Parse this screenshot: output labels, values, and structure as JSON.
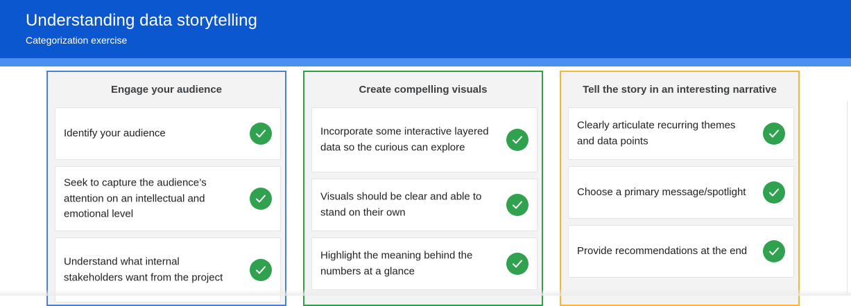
{
  "header": {
    "title": "Understanding data storytelling",
    "subtitle": "Categorization exercise"
  },
  "colors": {
    "header_bg": "#0b57d0",
    "header_strip": "#4a90f0",
    "column_1_border": "#4a80cf",
    "column_2_border": "#2f9e47",
    "column_3_border": "#f2b836",
    "check_fill": "#2fa14f"
  },
  "columns": [
    {
      "title": "Engage your audience",
      "items": [
        {
          "text": "Identify your audience",
          "icon": "check-circle-icon"
        },
        {
          "text": "Seek to capture the audience’s attention on an intellectual and emotional level",
          "icon": "check-circle-icon"
        },
        {
          "text": "Understand what internal stakeholders want from the project",
          "icon": "check-circle-icon"
        }
      ]
    },
    {
      "title": "Create compelling visuals",
      "items": [
        {
          "text": "Incorporate some interactive layered data so the curious can explore",
          "icon": "check-circle-icon"
        },
        {
          "text": "Visuals should be clear and able to stand on their own",
          "icon": "check-circle-icon"
        },
        {
          "text": "Highlight the meaning behind the numbers at a glance",
          "icon": "check-circle-icon"
        }
      ]
    },
    {
      "title": "Tell the story in an interesting narrative",
      "items": [
        {
          "text": "Clearly articulate recurring themes and data points",
          "icon": "check-circle-icon"
        },
        {
          "text": "Choose a primary message/spotlight",
          "icon": "check-circle-icon"
        },
        {
          "text": "Provide recommendations at the end",
          "icon": "check-circle-icon"
        }
      ]
    }
  ]
}
